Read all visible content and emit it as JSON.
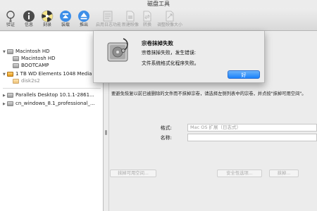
{
  "window": {
    "title": "磁盘工具"
  },
  "toolbar": {
    "items": [
      {
        "label": "验证",
        "icon": "stethoscope-icon",
        "enabled": true
      },
      {
        "label": "信息",
        "icon": "info-icon",
        "enabled": true
      },
      {
        "label": "刻录",
        "icon": "burn-icon",
        "enabled": true
      },
      {
        "label": "装载",
        "icon": "mount-icon",
        "enabled": true
      },
      {
        "label": "推出",
        "icon": "eject-icon",
        "enabled": true
      },
      {
        "label": "启用日志功能",
        "icon": "journal-icon",
        "enabled": false
      },
      {
        "label": "新建映像",
        "icon": "new-image-icon",
        "enabled": false
      },
      {
        "label": "转换",
        "icon": "convert-icon",
        "enabled": false
      },
      {
        "label": "调整映像大小",
        "icon": "resize-image-icon",
        "enabled": false
      }
    ]
  },
  "sidebar": {
    "items": [
      {
        "label": "Macintosh HD",
        "icon": "hard-disk-icon"
      },
      {
        "label": "Macintosh HD",
        "icon": "volume-icon"
      },
      {
        "label": "BOOTCAMP",
        "icon": "volume-icon"
      },
      {
        "label": "1 TB WD Elements 1048 Media",
        "icon": "external-disk-icon"
      },
      {
        "label": "disk2s2",
        "icon": "volume-icon"
      },
      {
        "label": "Parallels Desktop 10.1.1-2861...",
        "icon": "disk-image-icon"
      },
      {
        "label": "cn_windows_8.1_professional_...",
        "icon": "disk-image-icon"
      }
    ]
  },
  "main": {
    "info_text": "要避免恢复以前已被删除的文件而不抹掉宗卷，请选择左侧列表中的宗卷，并点按\"抹掉可用空间\"。",
    "format_label": "格式:",
    "format_value": "Mac OS 扩展（日志式）",
    "name_label": "名称:",
    "name_value": "",
    "erase_free_space_button": "抹掉可用空间...",
    "security_options_button": "安全性选项...",
    "erase_button": "抹掉..."
  },
  "dialog": {
    "title": "宗卷抹掉失败",
    "message_line1": "宗卷抹掉失败，发生错误:",
    "message_line2": "文件系统格式化程序失败。",
    "ok_button": "好"
  },
  "colors": {
    "accent": "#1a82fb",
    "window_bg": "#ececec",
    "sidebar_bg": "#ffffff"
  }
}
